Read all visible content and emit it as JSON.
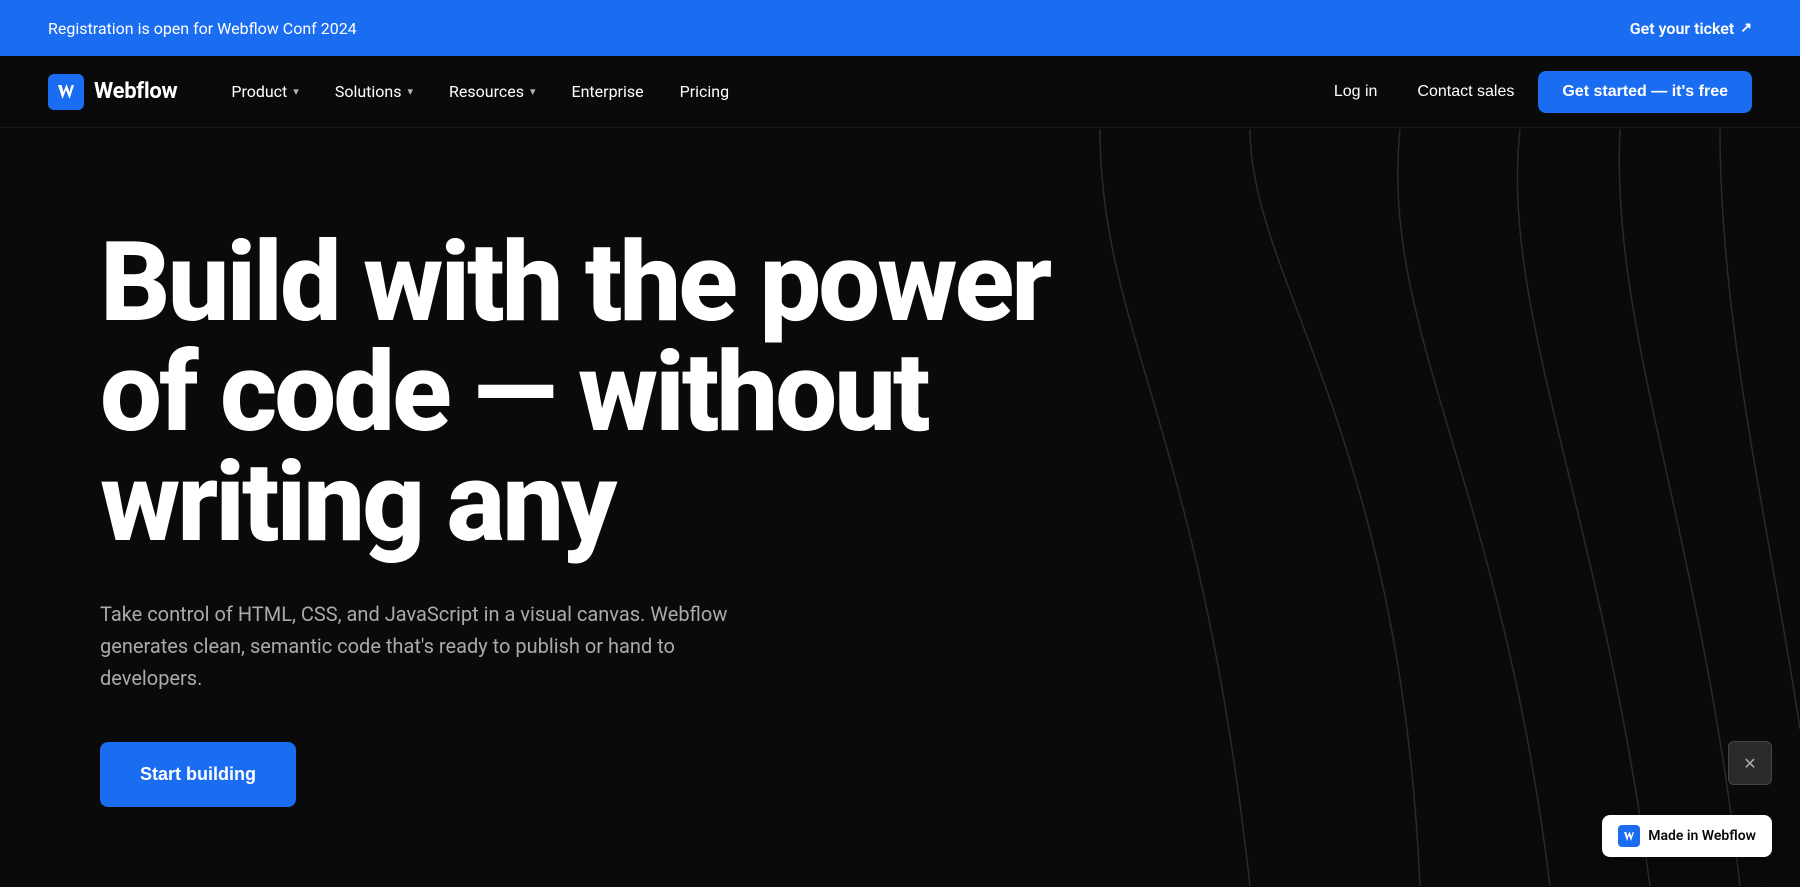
{
  "announcement": {
    "text": "Registration is open for Webflow Conf 2024",
    "link_text": "Get your ticket",
    "link_icon": "↗"
  },
  "navbar": {
    "logo_text": "Webflow",
    "nav_items": [
      {
        "label": "Product",
        "has_dropdown": true
      },
      {
        "label": "Solutions",
        "has_dropdown": true
      },
      {
        "label": "Resources",
        "has_dropdown": true
      },
      {
        "label": "Enterprise",
        "has_dropdown": false
      },
      {
        "label": "Pricing",
        "has_dropdown": false
      }
    ],
    "right_items": [
      {
        "label": "Log in",
        "type": "text"
      },
      {
        "label": "Contact sales",
        "type": "text"
      },
      {
        "label": "Get started — it's free",
        "type": "primary"
      }
    ]
  },
  "hero": {
    "headline_line1": "Build with the power",
    "headline_line2": "of code — without",
    "headline_line3": "writing any",
    "subtext": "Take control of HTML, CSS, and JavaScript in a visual canvas. Webflow generates clean, semantic code that's ready to publish or hand to developers.",
    "cta_label": "Start building"
  },
  "made_in_webflow": {
    "label": "Made in Webflow"
  },
  "colors": {
    "accent": "#1a6cf0",
    "bg": "#0a0a0a",
    "text_muted": "#aaa"
  }
}
